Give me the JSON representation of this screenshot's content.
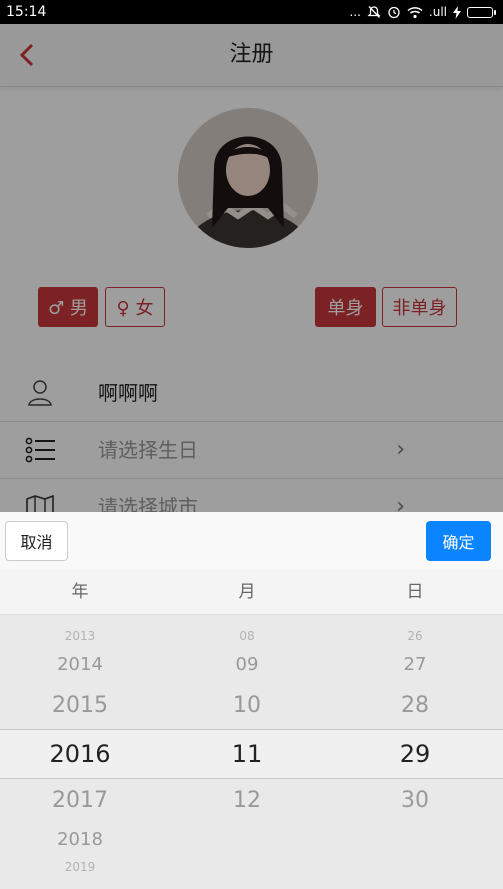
{
  "status_bar": {
    "time": "15:14",
    "dots": "...",
    "signal": ".ull"
  },
  "header": {
    "title": "注册"
  },
  "gender": {
    "male": "♂ 男",
    "female": "♀ 女"
  },
  "relationship": {
    "single": "单身",
    "not_single": "非单身"
  },
  "form": {
    "nickname": "啊啊啊",
    "birthday_placeholder": "请选择生日",
    "city_placeholder": "请选择城市"
  },
  "picker": {
    "cancel_label": "取消",
    "confirm_label": "确定",
    "columns": [
      "年",
      "月",
      "日"
    ],
    "years": [
      "2013",
      "2014",
      "2015",
      "2016",
      "2017",
      "2018",
      "2019"
    ],
    "months": [
      "08",
      "09",
      "10",
      "11",
      "12"
    ],
    "days": [
      "26",
      "27",
      "28",
      "29",
      "30"
    ],
    "selected": {
      "year": "2016",
      "month": "11",
      "day": "29"
    }
  },
  "colors": {
    "accent_red": "#c8373a",
    "confirm_blue": "#0a84ff"
  }
}
